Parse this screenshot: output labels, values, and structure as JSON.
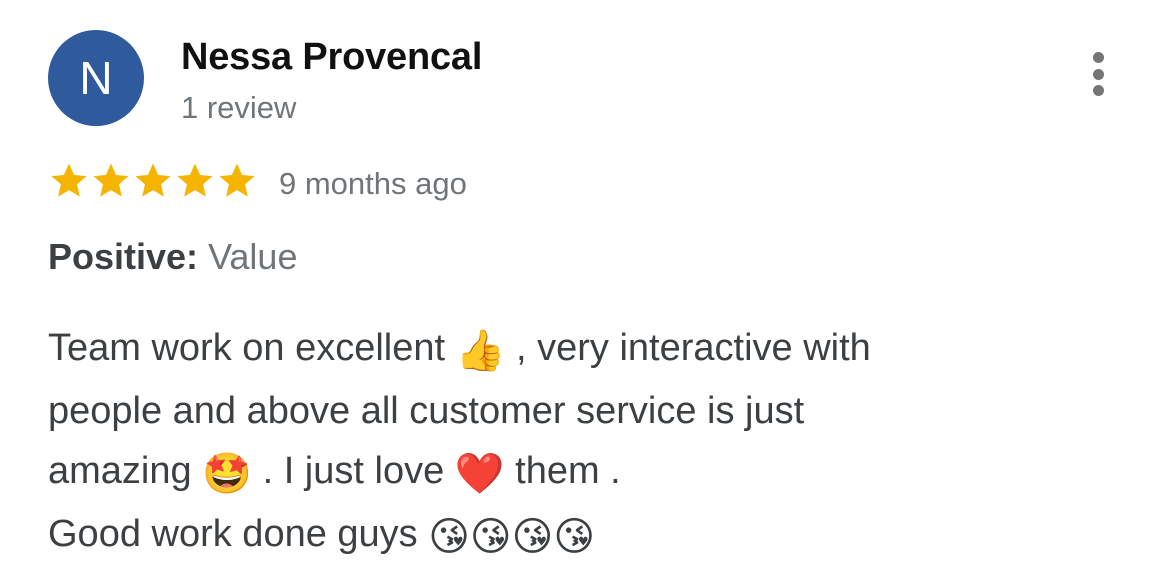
{
  "review": {
    "avatar_letter": "N",
    "avatar_color": "#2f5a9b",
    "author_name": "Nessa Provencal",
    "author_reviews": "1 review",
    "rating": 5,
    "rating_max": 5,
    "star_color": "#f4b400",
    "time_ago": "9 months ago",
    "positive_label": "Positive:",
    "positive_value": "Value",
    "text_lines": [
      [
        "Team work on excellent ",
        "👍",
        " , very interactive with"
      ],
      [
        "people and above all customer service is just"
      ],
      [
        "amazing ",
        "🤩",
        "  . I just love ",
        "❤️",
        " them ."
      ],
      [
        "Good work done guys ",
        "😘😘😘😘"
      ]
    ]
  },
  "icons": {
    "menu": "more-vert-icon",
    "star": "star-icon"
  }
}
